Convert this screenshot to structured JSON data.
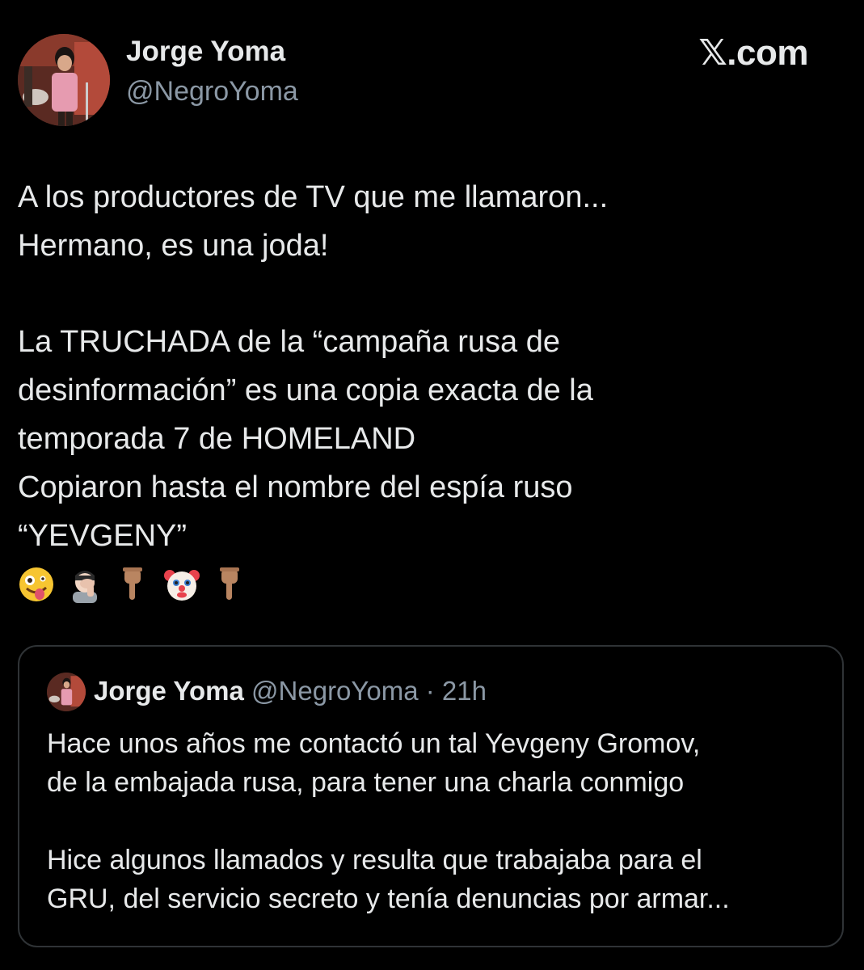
{
  "header": {
    "author_name": "Jorge Yoma",
    "author_handle": "@NegroYoma",
    "brand": "𝕏.com"
  },
  "tweet": {
    "lines": [
      "A los productores de TV que me llamaron...",
      "Hermano, es una joda!",
      "",
      "La TRUCHADA  de la “campaña rusa de",
      "desinformación” es una copia exacta de la",
      "temporada 7 de HOMELAND",
      "Copiaron hasta el nombre del espía ruso",
      "“YEVGENY”"
    ],
    "emojis": [
      "zany-face-emoji",
      "man-facepalming-emoji",
      "pointing-down-emoji",
      "clown-face-emoji",
      "pointing-down-emoji"
    ]
  },
  "quoted": {
    "author_name": "Jorge Yoma",
    "author_handle": "@NegroYoma",
    "separator": " · ",
    "time": "21h",
    "lines": [
      "Hace unos años me contactó un tal Yevgeny Gromov,",
      "de la embajada rusa, para tener una charla conmigo",
      "",
      "Hice algunos llamados y resulta que trabajaba para el",
      "GRU, del servicio secreto y tenía denuncias por armar..."
    ]
  },
  "colors": {
    "background": "#000000",
    "text": "#e7e9ea",
    "secondary_text": "#8b98a5",
    "border": "#2f3336"
  }
}
